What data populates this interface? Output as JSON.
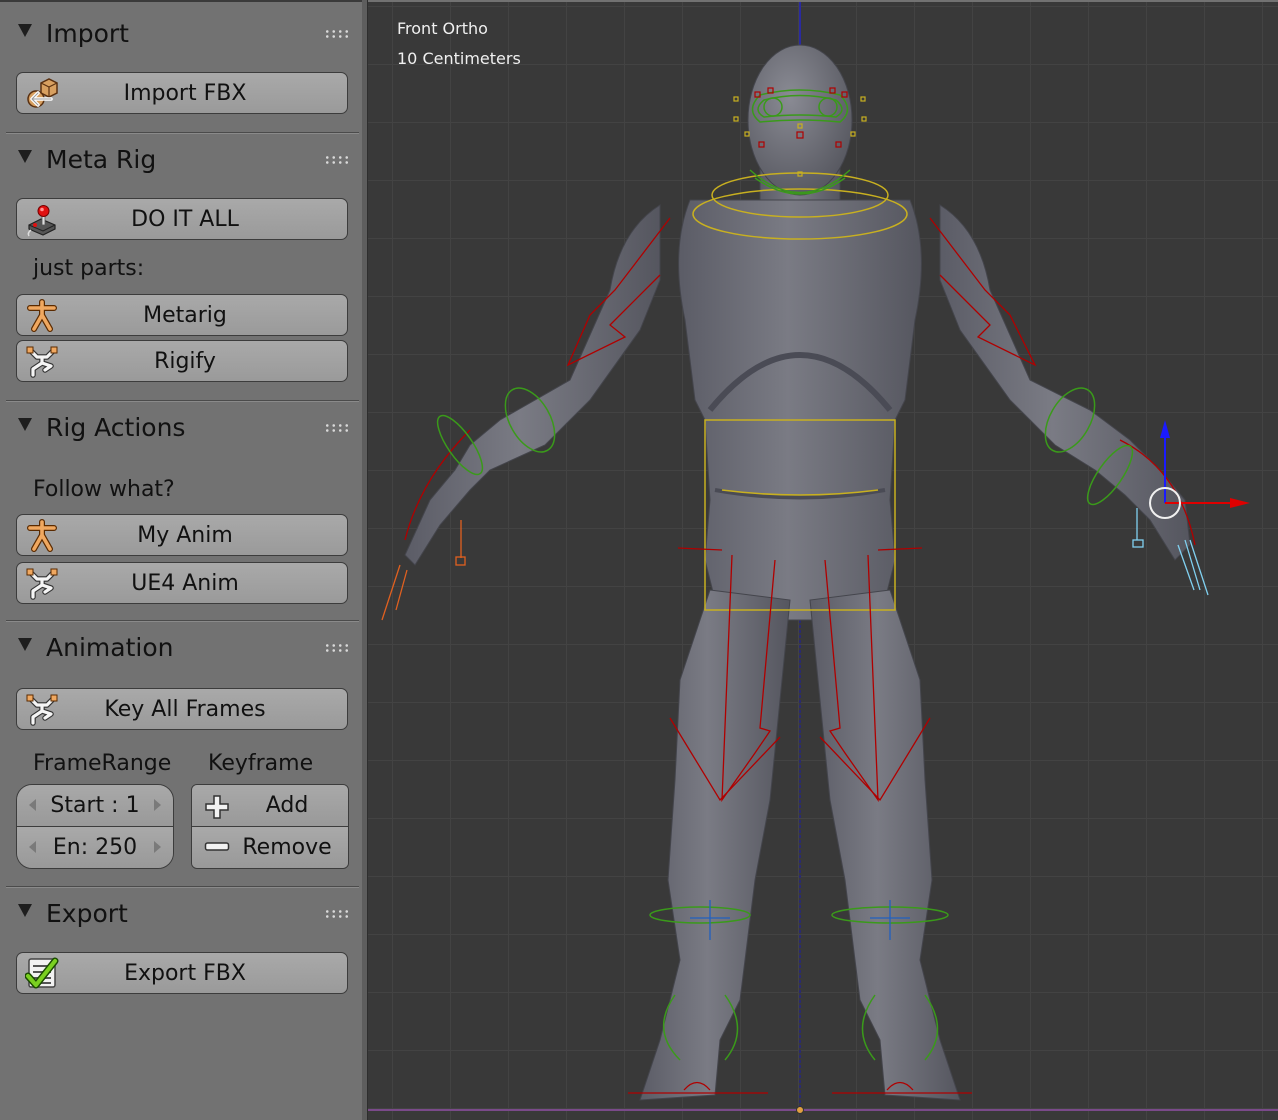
{
  "sidebar": {
    "panels": {
      "import": {
        "title": "Import",
        "buttons": {
          "import_fbx": "Import FBX"
        }
      },
      "meta_rig": {
        "title": "Meta Rig",
        "buttons": {
          "do_it_all": "DO IT ALL",
          "metarig": "Metarig",
          "rigify": "Rigify"
        },
        "subheading": "just parts:"
      },
      "rig_actions": {
        "title": "Rig Actions",
        "subheading": "Follow what?",
        "buttons": {
          "my_anim": "My Anim",
          "ue4_anim": "UE4 Anim"
        }
      },
      "animation": {
        "title": "Animation",
        "buttons": {
          "key_all_frames": "Key All Frames"
        },
        "frame_range": {
          "label": "FrameRange",
          "start_label": "Start : 1",
          "start_value": 1,
          "end_label": "En:  250",
          "end_value": 250
        },
        "keyframe": {
          "label": "Keyframe",
          "add": "Add",
          "remove": "Remove"
        }
      },
      "export": {
        "title": "Export",
        "buttons": {
          "export_fbx": "Export FBX"
        }
      }
    },
    "icons": {
      "import": "import-box-arrow-icon",
      "do_it_all": "joystick-icon",
      "metarig": "armature-figure-icon",
      "rigify": "running-figure-icon",
      "add": "plus-icon",
      "remove": "minus-icon",
      "export": "checklist-icon"
    }
  },
  "viewport": {
    "view_name": "Front Ortho",
    "grid_scale": "10 Centimeters",
    "colors": {
      "background": "#393939",
      "bone_red": "#b00000",
      "control_green": "#3a9a1a",
      "control_yellow": "#c8b020",
      "axis_blue": "#1a1aff",
      "axis_red": "#e00000"
    }
  }
}
